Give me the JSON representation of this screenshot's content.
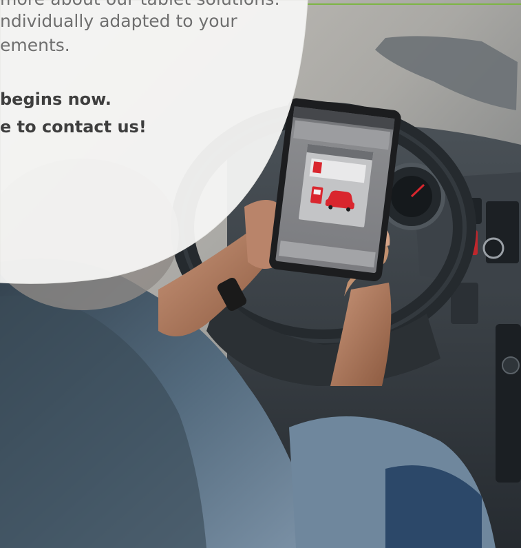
{
  "colors": {
    "accent_green": "#7db544",
    "bubble_white": "#f6f6f4",
    "body_text": "#6f6f6f",
    "bold_text": "#3e3e3e",
    "tablet_red": "#d9262e"
  },
  "copy": {
    "line1": "more about our tablet solutions:",
    "line2": "ndividually adapted to your",
    "line3": "ements.",
    "line4": "begins now.",
    "line5": "e to contact us!"
  },
  "photo": {
    "subject": "driver-using-tablet-in-truck-cab",
    "icons": [
      "fuel-pump-icon",
      "car-icon"
    ]
  }
}
